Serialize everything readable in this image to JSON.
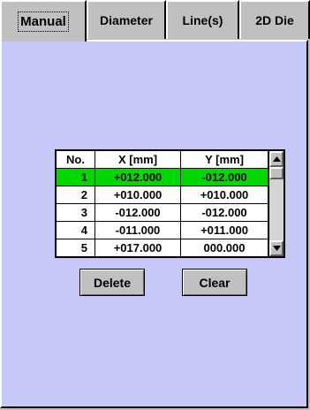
{
  "tabs": [
    {
      "label": "Manual",
      "active": true
    },
    {
      "label": "Diameter",
      "active": false
    },
    {
      "label": "Line(s)",
      "active": false
    },
    {
      "label": "2D Die",
      "active": false
    }
  ],
  "table": {
    "headers": {
      "no": "No.",
      "x": "X [mm]",
      "y": "Y [mm]"
    },
    "rows": [
      {
        "no": "1",
        "x": "+012.000",
        "y": "-012.000",
        "selected": true
      },
      {
        "no": "2",
        "x": "+010.000",
        "y": "+010.000",
        "selected": false
      },
      {
        "no": "3",
        "x": "-012.000",
        "y": "-012.000",
        "selected": false
      },
      {
        "no": "4",
        "x": "-011.000",
        "y": "+011.000",
        "selected": false
      },
      {
        "no": "5",
        "x": "+017.000",
        "y": "000.000",
        "selected": false
      }
    ]
  },
  "buttons": {
    "delete": "Delete",
    "clear": "Clear"
  },
  "colors": {
    "panel": "#c8c8f8",
    "selected_row": "#00d800",
    "chrome": "#c0c0c0"
  },
  "icons": {
    "scroll_up": "triangle-up",
    "scroll_down": "triangle-down"
  }
}
